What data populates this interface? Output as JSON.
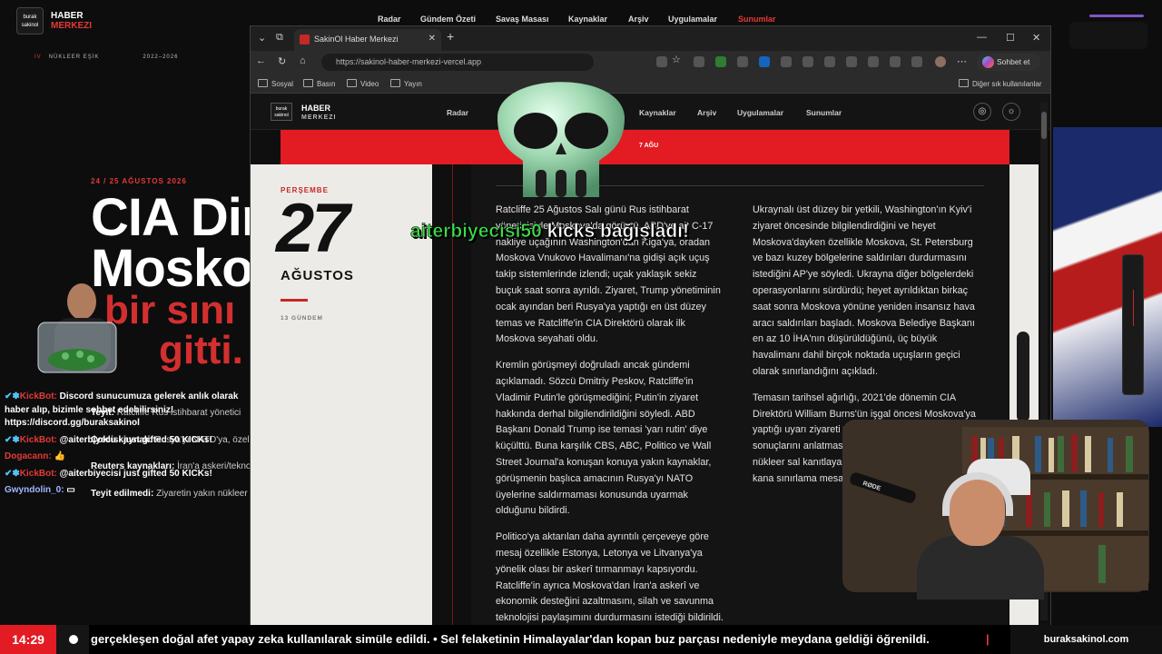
{
  "background_site": {
    "logo_text": "burak sakinol",
    "brand_line1": "HABER",
    "brand_line2": "MERKEZI",
    "nav": [
      "Radar",
      "Gündem Özeti",
      "Savaş Masası",
      "Kaynaklar",
      "Arşiv",
      "Uygulamalar",
      "Sunumlar"
    ],
    "tagline_prefix": "IV",
    "tagline": "NÜKLEER EŞİK",
    "tagline_years": "2022–2026",
    "date": "24 / 25 AĞUSTOS 2026",
    "headline_1": "CIA Dir",
    "headline_2": "Mosko",
    "headline_red_1": "bir sını",
    "headline_red_2": "gitti.",
    "items": [
      {
        "label": "Teyit:",
        "text": "Ratcliffe Rus istihbarat yönetici"
      },
      {
        "label": "Çoklu kaynak:",
        "text": "Rusya'yı NATO'ya, özell"
      },
      {
        "label": "Reuters kaynakları:",
        "text": "İran'a askeri/tekno"
      },
      {
        "label": "Teyit edilmedi:",
        "text": "Ziyaretin yakın nükleer"
      }
    ]
  },
  "browser": {
    "tab_title": "SakinOl Haber Merkezi",
    "url": "https://sakinol-haber-merkezi-vercel.app",
    "chat_button": "Sohbet et",
    "bookmarks": [
      "Sosyal",
      "Basın",
      "Video",
      "Yayın"
    ],
    "other_bookmarks": "Diğer sık kullanılanlar"
  },
  "site": {
    "logo_text": "burak sakinol",
    "brand_line1": "HABER",
    "brand_line2": "MERKEZI",
    "nav": [
      "Radar",
      "Kaynaklar",
      "Arşiv",
      "Uygulamalar",
      "Sunumlar"
    ],
    "band_text": "7 AĞU",
    "day_name": "PERŞEMBE",
    "day_number": "27",
    "month": "AĞUSTOS",
    "count": "13 GÜNDEM",
    "col1": [
      "Ratcliffe 25 Ağustos Salı günü Rus istihbarat yöneticisiyle Moskova'da görüştü. ABD'ye ait C-17 nakliye uçağının Washington'dan Riga'ya, oradan Moskova Vnukovo Havalimanı'na gidişi açık uçuş takip sistemlerinde izlendi; uçak yaklaşık sekiz buçuk saat sonra ayrıldı. Ziyaret, Trump yönetiminin ocak ayından beri Rusya'ya yaptığı en üst düzey temas ve Ratcliffe'in CIA Direktörü olarak ilk Moskova seyahati oldu.",
      "Kremlin görüşmeyi doğruladı ancak gündemi açıklamadı. Sözcü Dmitriy Peskov, Ratcliffe'in Vladimir Putin'le görüşmediğini; Putin'in ziyaret hakkında derhal bilgilendirildiğini söyledi. ABD Başkanı Donald Trump ise temasi 'yarı rutin' diye küçülttü. Buna karşılık CBS, ABC, Politico ve Wall Street Journal'a konuşan konuya yakın kaynaklar, görüşmenin başlıca amacının Rusya'yı NATO üyelerine saldırmaması konusunda uyarmak olduğunu bildirdi.",
      "Politico'ya aktarılan daha ayrıntılı çerçeveye göre mesaj özellikle Estonya, Letonya ve Litvanya'ya yönelik olası bir askerî tırmanmayı kapsıyordu. Ratcliffe'in ayrıca Moskova'dan İran'a askerî ve ekonomik desteğini azaltmasını, silah ve savunma teknolojisi paylaşımını durdurmasını istediği bildirildi."
    ],
    "col2": [
      "Ukraynalı üst düzey bir yetkili, Washington'ın Kyiv'i ziyaret öncesinde bilgilendirdiğini ve heyet Moskova'dayken özellikle Moskova, St. Petersburg ve bazı kuzey bölgelerine saldırıları durdurmasını istediğini AP'ye söyledi. Ukrayna diğer bölgelerdeki operasyonlarını sürdürdü; heyet ayrıldıktan birkaç saat sonra Moskova yönüne yeniden insansız hava aracı saldırıları başladı. Moskova Belediye Başkanı en az 10 İHA'nın düşürüldüğünü, üç büyük havalimanı dahil birçok noktada uçuşların geçici olarak sınırlandığını açıkladı.",
      "Temasın tarihsel ağırlığı, 2021'de dönemin CIA Direktörü William Burns'ün işgal öncesi Moskova'ya yaptığı uyarı ziyareti v Sergey Narışkin'e nü sonuçlarını anlatmas mevcut açık kaynakl 'yakın bir nükleer sal kanıtlayan bilgi bulun NATO'nun doğu kana sınırlama mesajı."
    ]
  },
  "overlay": {
    "donation_user": "aiterbiyecisi50",
    "donation_text": "kicks bağışladı!",
    "mic_label": "RØDE"
  },
  "chat": [
    {
      "user": "KickBot:",
      "text": "Discord sunucumuza gelerek anlık olarak haber alıp, bizimle sohbet edebilirsiniz! https://discord.gg/buraksakinol"
    },
    {
      "user": "KickBot:",
      "text": "@aiterbiyecisi just gifted 50 KICKs!"
    },
    {
      "user": "Dogacann:",
      "text": "👍"
    },
    {
      "user": "KickBot:",
      "text": "@aiterbiyecisi just gifted 50 KICKs!"
    },
    {
      "user": "Gwyndolin_0:",
      "text": "▭"
    }
  ],
  "ticker": {
    "time": "14:29",
    "text": "gerçekleşen doğal afet yapay zeka kullanılarak simüle edildi. • Sel felaketinin Himalayalar'dan kopan buz parçası nedeniyle meydana geldiği öğrenildi.",
    "separator": "|",
    "site": "buraksakinol.com"
  },
  "colors": {
    "accent": "#e31b23",
    "page_bg": "#0f0f10",
    "paper": "#ecebe7"
  }
}
